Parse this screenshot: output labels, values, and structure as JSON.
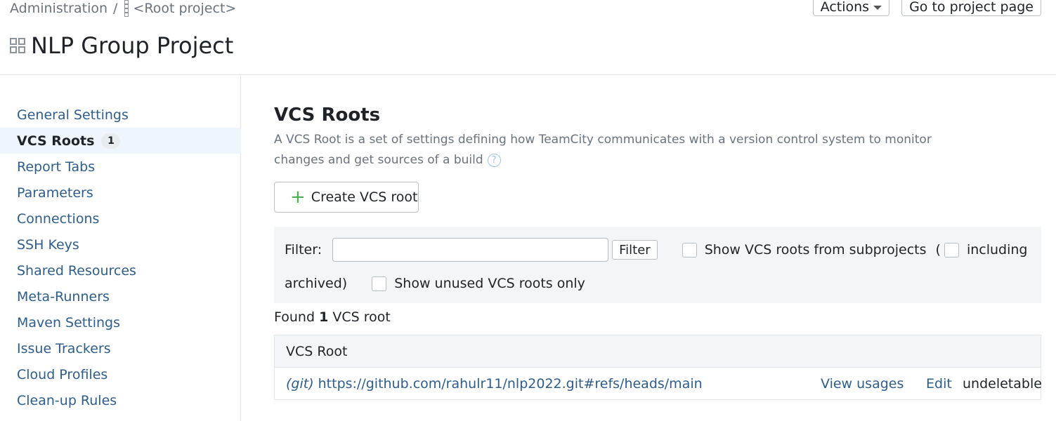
{
  "breadcrumb": {
    "admin": "Administration",
    "separator": "/",
    "root_project": "<Root project>"
  },
  "header": {
    "actions_label": "Actions",
    "go_to_project_label": "Go to project page"
  },
  "project": {
    "title": "NLP Group Project"
  },
  "sidebar": {
    "items": [
      {
        "label": "General Settings"
      },
      {
        "label": "VCS Roots",
        "badge": "1",
        "active": true
      },
      {
        "label": "Report Tabs"
      },
      {
        "label": "Parameters"
      },
      {
        "label": "Connections"
      },
      {
        "label": "SSH Keys"
      },
      {
        "label": "Shared Resources"
      },
      {
        "label": "Meta-Runners"
      },
      {
        "label": "Maven Settings"
      },
      {
        "label": "Issue Trackers"
      },
      {
        "label": "Cloud Profiles"
      },
      {
        "label": "Clean-up Rules"
      }
    ]
  },
  "main": {
    "title": "VCS Roots",
    "description": "A VCS Root is a set of settings defining how TeamCity communicates with a version control system to monitor changes and get sources of a build",
    "help_icon": "question-circle",
    "create_label": "Create VCS root",
    "filter": {
      "label": "Filter:",
      "input_value": "",
      "button_label": "Filter",
      "show_subprojects_label": "Show VCS roots from subprojects",
      "open_paren": "(",
      "including_label": "including",
      "archived_label": "archived)",
      "unused_only_label": "Show unused VCS roots only"
    },
    "found": {
      "prefix": "Found",
      "count": "1",
      "suffix": "VCS root"
    },
    "table": {
      "header": "VCS Root",
      "rows": [
        {
          "type": "(git)",
          "url": "https://github.com/rahulr11/nlp2022.git#refs/heads/main",
          "view_usages": "View usages",
          "edit": "Edit",
          "status": "undeletable"
        }
      ]
    }
  },
  "colors": {
    "link": "#2f5d8a",
    "active_bg": "#eef5fd",
    "panel_bg": "#f4f5f6",
    "accent_green": "#4caf50"
  }
}
